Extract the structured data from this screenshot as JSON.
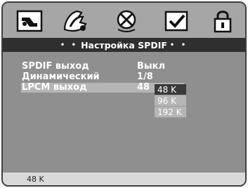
{
  "icon_bar": {
    "icons": [
      {
        "name": "language-icon"
      },
      {
        "name": "audio-icon"
      },
      {
        "name": "video-off-icon"
      },
      {
        "name": "preferences-check-icon"
      },
      {
        "name": "password-lock-icon"
      }
    ]
  },
  "title": "Настройка SPDIF",
  "title_dots": "• •",
  "settings": [
    {
      "label": "SPDIF выход",
      "value": "Выкл"
    },
    {
      "label": "Динамический",
      "value": "1/8"
    },
    {
      "label": "LPCM выход",
      "value": "48"
    }
  ],
  "dropdown_options": [
    "48 K",
    "96 K",
    "192 K"
  ],
  "dropdown_selected": "48 K",
  "status": "48 K",
  "colors": {
    "frame": "#3f3f3f",
    "icon_bg": "#a6a6a6",
    "title_bg": "#2f2f2f",
    "content_bg": "#8f8f8f",
    "highlight": "#b5b5b5",
    "status_bg": "#d9d9d9"
  }
}
